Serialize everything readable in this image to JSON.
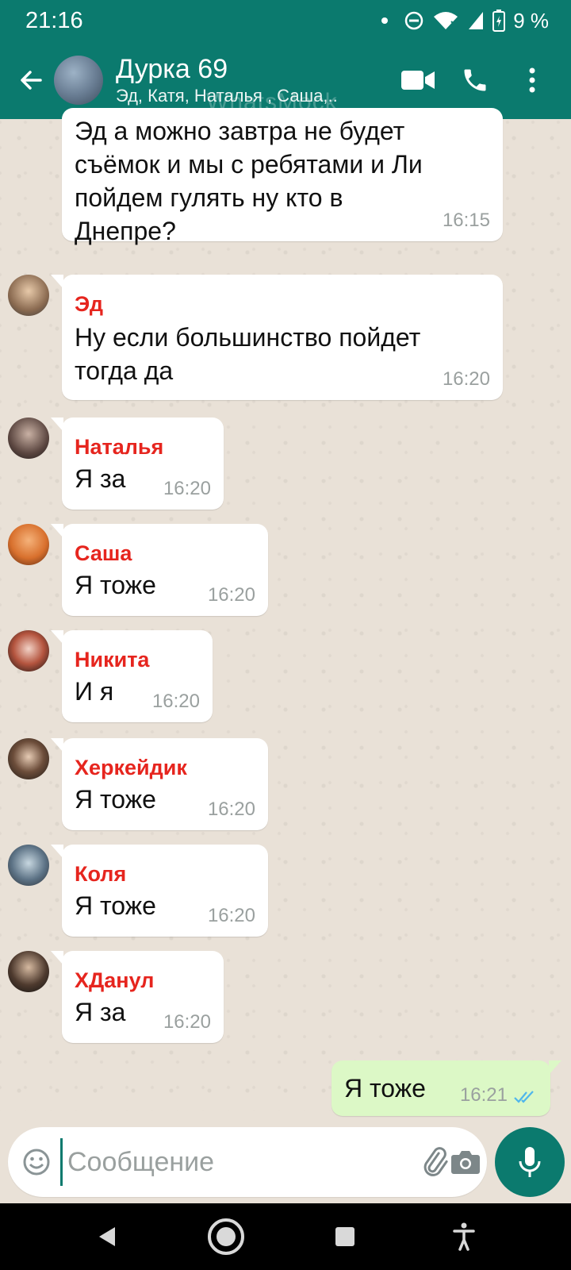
{
  "status_bar": {
    "time": "21:16",
    "battery": "9 %"
  },
  "header": {
    "title": "Дурка 69",
    "subtitle": "Эд, Катя, Наталья , Саша,..",
    "watermark": "WhatsMock"
  },
  "messages": [
    {
      "sender": "",
      "text": "Эд а можно завтра не будет съёмок и мы с ребятами и Ли пойдем гулять ну кто в Днепре?",
      "time": "16:15"
    },
    {
      "sender": "Эд",
      "text": "Ну если большинство пойдет тогда да",
      "time": "16:20"
    },
    {
      "sender": "Наталья",
      "text": "Я за",
      "time": "16:20"
    },
    {
      "sender": "Саша",
      "text": "Я тоже",
      "time": "16:20"
    },
    {
      "sender": "Никита",
      "text": "И я",
      "time": "16:20"
    },
    {
      "sender": "Херкейдик",
      "text": "Я тоже",
      "time": "16:20"
    },
    {
      "sender": "Коля",
      "text": "Я тоже",
      "time": "16:20"
    },
    {
      "sender": "ХДанул",
      "text": "Я за",
      "time": "16:20"
    }
  ],
  "outgoing": {
    "text": "Я тоже",
    "time": "16:21",
    "status": "read"
  },
  "composer": {
    "placeholder": "Сообщение"
  },
  "colors": {
    "primary": "#0b7a6e",
    "sender_name": "#e6251e",
    "outgoing_bubble": "#dcf8c6",
    "read_ticks": "#4fb6ec"
  }
}
